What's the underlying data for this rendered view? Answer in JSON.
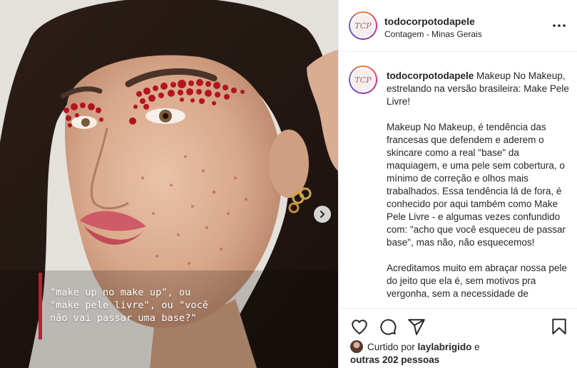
{
  "post": {
    "account": {
      "username": "todocorpotodapele",
      "location": "Contagem - Minas Gerais",
      "avatar_monogram": "TCP"
    },
    "media": {
      "overlay_caption_lines": [
        "\"make up no make up\", ou",
        "\"make pele livre\", ou \"você",
        "não vai passar uma base?\""
      ],
      "accent_color": "#b32430",
      "next_icon": "chevron-right-icon"
    },
    "caption": {
      "username": "todocorpotodapele",
      "text": " Makeup No Makeup, estrelando na versão brasileira: Make Pele Livre!\n\nMakeup No Makeup, é tendência das francesas que defendem e aderem o skincare como a real \"base\" da maquiagem, e uma pele sem cobertura, o mínimo de correção e olhos mais trabalhados. Essa tendência lá de fora, é conhecido por aqui também como Make Pele Livre - e algumas vezes confundido com: \"acho que você esqueceu de passar base\", mas não, não esquecemos!\n\nAcreditamos muito em abraçar nossa pele do jeito que ela é, sem motivos pra vergonha, sem a necessidade de"
    },
    "actions": {
      "like_icon": "heart-icon",
      "comment_icon": "comment-icon",
      "share_icon": "share-icon",
      "save_icon": "bookmark-icon"
    },
    "likes": {
      "prefix": "Curtido por ",
      "user": "laylabrigido",
      "middle": " e",
      "others": "outras 202 pessoas"
    }
  }
}
